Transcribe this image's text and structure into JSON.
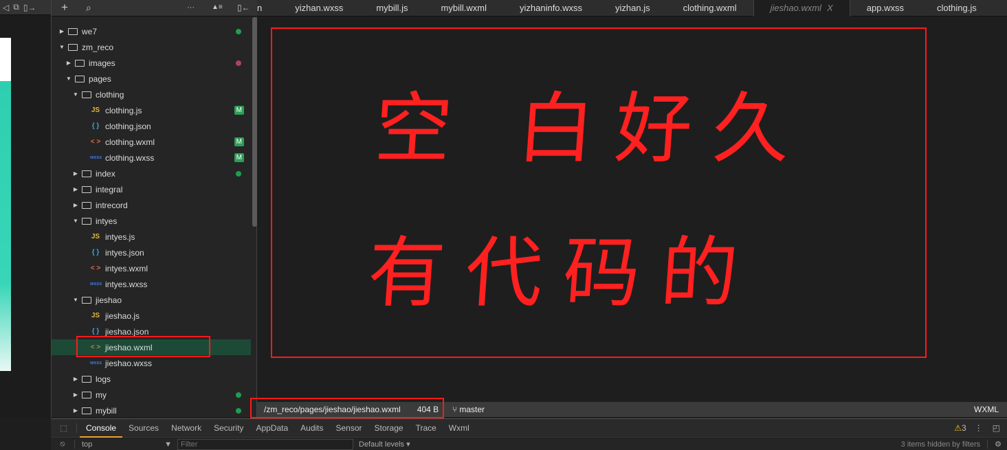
{
  "simulator": {
    "icons": [
      "speaker-icon",
      "window-icon",
      "dock-icon"
    ]
  },
  "explorer": {
    "toolbar": {
      "add": "+",
      "search": "⌕",
      "more": "···",
      "collapse": "▲≡",
      "dock": "▯←"
    },
    "rows": [
      {
        "label": "we7",
        "kind": "folder",
        "level": 0,
        "open": false,
        "dot": "#1e9e4e"
      },
      {
        "label": "zm_reco",
        "kind": "folder",
        "level": 0,
        "open": true
      },
      {
        "label": "images",
        "kind": "folder",
        "level": 1,
        "open": false,
        "dot": "#b0406a"
      },
      {
        "label": "pages",
        "kind": "folder",
        "level": 1,
        "open": true
      },
      {
        "label": "clothing",
        "kind": "folder",
        "level": 2,
        "open": true
      },
      {
        "label": "clothing.js",
        "kind": "js",
        "level": 3,
        "badge": "M"
      },
      {
        "label": "clothing.json",
        "kind": "json",
        "level": 3
      },
      {
        "label": "clothing.wxml",
        "kind": "wxml",
        "level": 3,
        "badge": "M"
      },
      {
        "label": "clothing.wxss",
        "kind": "wxss",
        "level": 3,
        "badge": "M"
      },
      {
        "label": "index",
        "kind": "folder",
        "level": 2,
        "open": false,
        "dot": "#1e9e4e"
      },
      {
        "label": "integral",
        "kind": "folder",
        "level": 2,
        "open": false
      },
      {
        "label": "intrecord",
        "kind": "folder",
        "level": 2,
        "open": false
      },
      {
        "label": "intyes",
        "kind": "folder",
        "level": 2,
        "open": true
      },
      {
        "label": "intyes.js",
        "kind": "js",
        "level": 3
      },
      {
        "label": "intyes.json",
        "kind": "json",
        "level": 3
      },
      {
        "label": "intyes.wxml",
        "kind": "wxml",
        "level": 3
      },
      {
        "label": "intyes.wxss",
        "kind": "wxss",
        "level": 3
      },
      {
        "label": "jieshao",
        "kind": "folder",
        "level": 2,
        "open": true
      },
      {
        "label": "jieshao.js",
        "kind": "js",
        "level": 3
      },
      {
        "label": "jieshao.json",
        "kind": "json",
        "level": 3
      },
      {
        "label": "jieshao.wxml",
        "kind": "wxml",
        "level": 3,
        "selected": true
      },
      {
        "label": "jieshao.wxss",
        "kind": "wxss",
        "level": 3
      },
      {
        "label": "logs",
        "kind": "folder",
        "level": 2,
        "open": false
      },
      {
        "label": "my",
        "kind": "folder",
        "level": 2,
        "open": false,
        "dot": "#1e9e4e"
      },
      {
        "label": "mybill",
        "kind": "folder",
        "level": 2,
        "open": false,
        "dot": "#1e9e4e"
      }
    ]
  },
  "tabs": [
    {
      "label": "n"
    },
    {
      "label": "yizhan.wxss"
    },
    {
      "label": "mybill.js"
    },
    {
      "label": "mybill.wxml"
    },
    {
      "label": "yizhaninfo.wxss"
    },
    {
      "label": "yizhan.js"
    },
    {
      "label": "clothing.wxml"
    },
    {
      "label": "jieshao.wxml",
      "active": true,
      "close": "X"
    },
    {
      "label": "app.wxss"
    },
    {
      "label": "clothing.js"
    }
  ],
  "annotation": {
    "line1": "空 白好久",
    "line2": "有代码的",
    "color": "#ff2020"
  },
  "status": {
    "path": "/zm_reco/pages/jieshao/jieshao.wxml",
    "size": "404 B",
    "branch": "master",
    "language": "WXML"
  },
  "devtools": {
    "tabs": [
      "Console",
      "Sources",
      "Network",
      "Security",
      "AppData",
      "Audits",
      "Sensor",
      "Storage",
      "Trace",
      "Wxml"
    ],
    "active": "Console",
    "warnings": "3",
    "context": "top",
    "filter_placeholder": "Filter",
    "levels": "Default levels",
    "hidden": "3 items hidden by filters"
  }
}
